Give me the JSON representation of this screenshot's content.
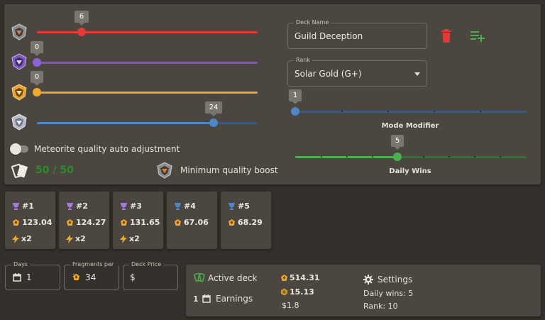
{
  "sliders": {
    "meteorite_1": {
      "value": "6",
      "fraction": 0.2,
      "color": "#e53935"
    },
    "meteorite_2": {
      "value": "0",
      "fraction": 0.0,
      "color": "#7e57c2"
    },
    "meteorite_3": {
      "value": "0",
      "fraction": 0.0,
      "color": "#e8a33a"
    },
    "meteorite_4": {
      "value": "24",
      "fraction": 0.8,
      "color": "#4f86c6"
    }
  },
  "auto_adjust_label": "Meteorite quality auto adjustment",
  "card_count": "50 / 50",
  "min_quality_boost_label": "Minimum quality boost",
  "deck": {
    "name_label": "Deck Name",
    "name_value": "Guild Deception",
    "rank_label": "Rank",
    "rank_value": "Solar Gold (G+)"
  },
  "mode_modifier": {
    "value": "1",
    "label": "Mode Modifier",
    "fraction": 0.0
  },
  "daily_wins": {
    "value": "5",
    "label": "Daily Wins",
    "fraction": 0.444
  },
  "ranks": [
    {
      "rank": "#1",
      "value": "123.04",
      "mult": "x2",
      "trophy_color": "#a77bd9"
    },
    {
      "rank": "#2",
      "value": "124.27",
      "mult": "x2",
      "trophy_color": "#a77bd9"
    },
    {
      "rank": "#3",
      "value": "131.65",
      "mult": "x2",
      "trophy_color": "#a77bd9"
    },
    {
      "rank": "#4",
      "value": "67.06",
      "mult": "",
      "trophy_color": "#4f86c6"
    },
    {
      "rank": "#5",
      "value": "68.29",
      "mult": "",
      "trophy_color": "#4f86c6"
    }
  ],
  "inputs": {
    "days_label": "Days",
    "days_value": "1",
    "fragments_label": "Fragments per ...",
    "fragments_value": "34",
    "price_label": "Deck Price",
    "price_value": "$"
  },
  "summary": {
    "active_deck_label": "Active deck",
    "earnings_count": "1",
    "earnings_label": "Earnings",
    "fragments": "514.31",
    "coins": "15.13",
    "dollars": "$1.8",
    "settings_label": "Settings",
    "daily_wins_text": "Daily wins: 5",
    "rank_text": "Rank: 10"
  },
  "colors": {
    "accent_green": "#4caf50",
    "delete_red": "#e53935",
    "card_count_green": "#2e8b2e",
    "fragment_gold": "#f0a928"
  }
}
